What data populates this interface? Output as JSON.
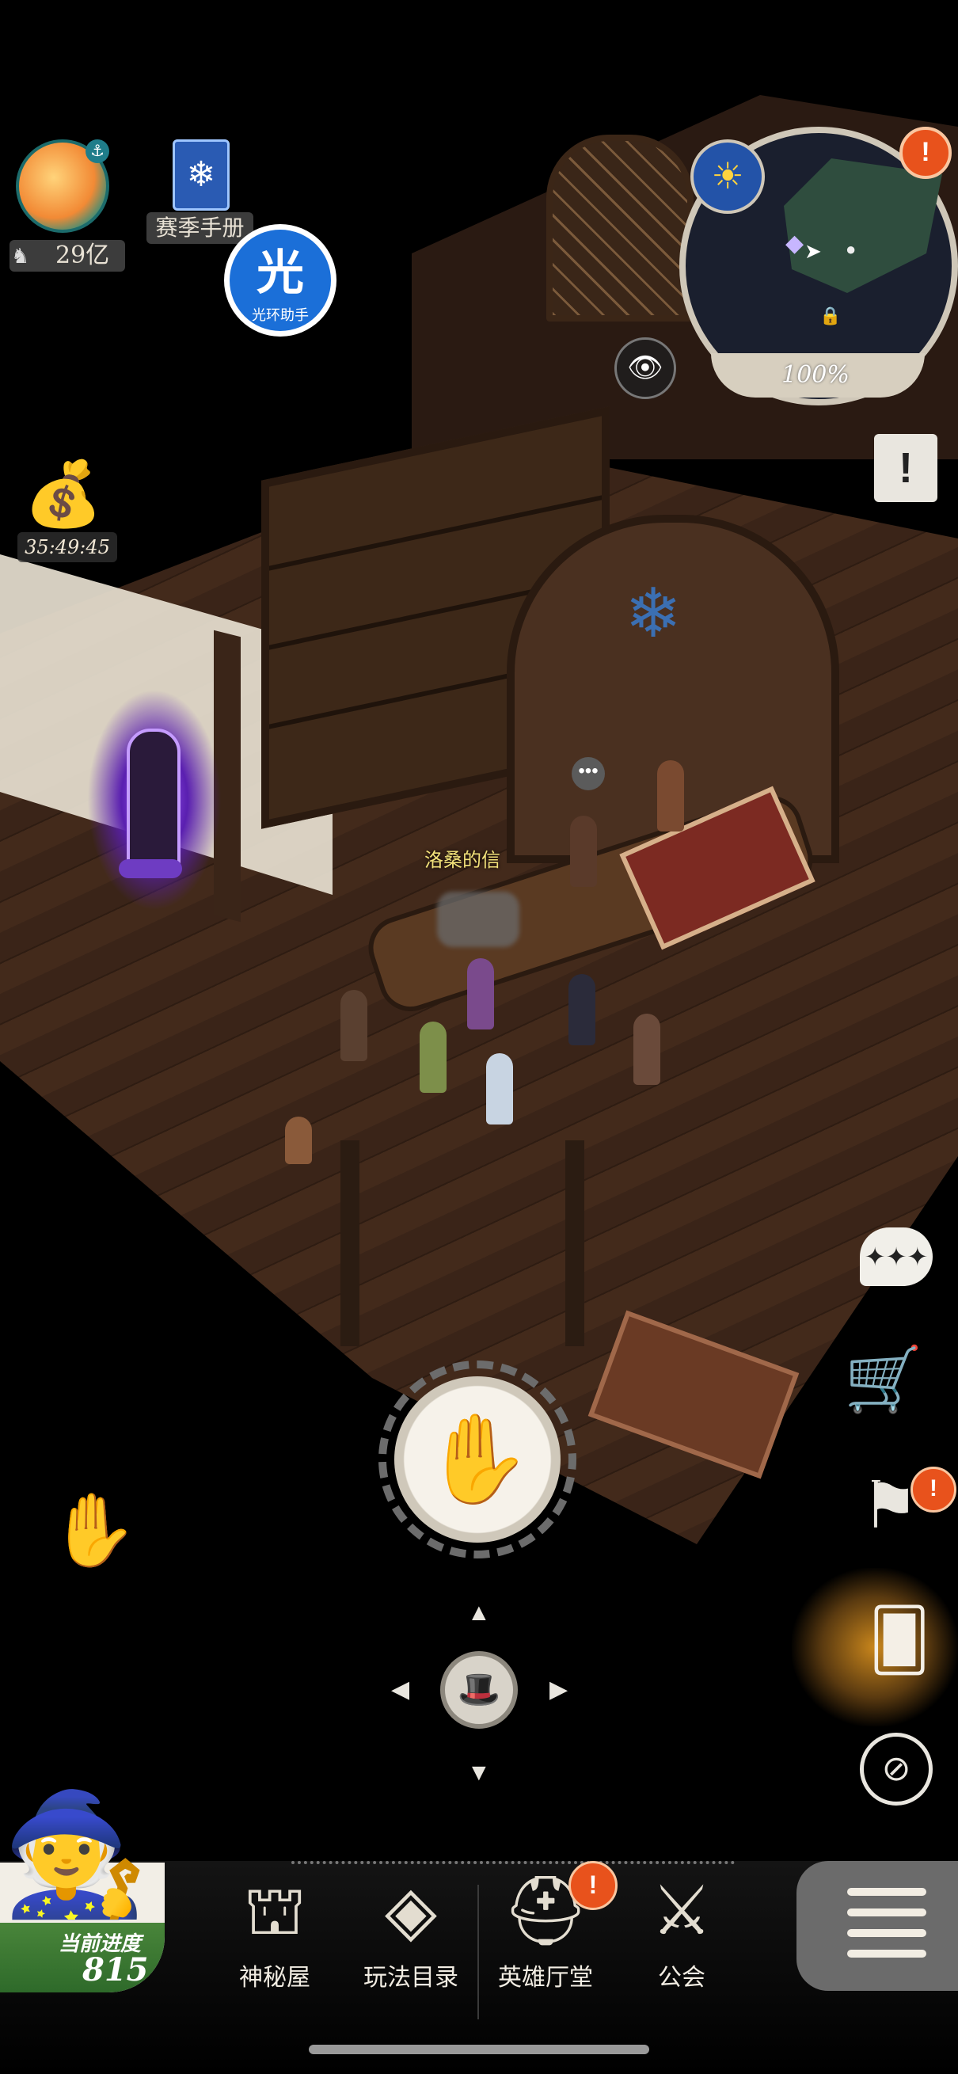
{
  "hud": {
    "currency_amount": "29亿",
    "season_book_label": "赛季手册",
    "helper_glyph": "光",
    "helper_label": "光环助手",
    "reward_timer": "35:49:45"
  },
  "minimap": {
    "completion": "100%",
    "alert_glyph": "!"
  },
  "scene": {
    "npc_label": "洛桑的信",
    "bubble_glyph": "•••"
  },
  "progress": {
    "label": "当前进度",
    "value": "815"
  },
  "bottom_nav": [
    {
      "label": "神秘屋",
      "icon": "mystery-house-icon"
    },
    {
      "label": "玩法目录",
      "icon": "gameplay-catalog-icon"
    },
    {
      "label": "英雄厅堂",
      "icon": "hero-hall-icon",
      "badge": "!"
    },
    {
      "label": "公会",
      "icon": "guild-icon"
    }
  ],
  "right_panel": {
    "chat_glyph": "✦✦✦",
    "flag_alert": "!"
  },
  "colors": {
    "alert": "#e8521c",
    "progress_green": "#49853a",
    "helper_blue": "#1b6fd8",
    "lamp_purple": "#a35cff"
  }
}
